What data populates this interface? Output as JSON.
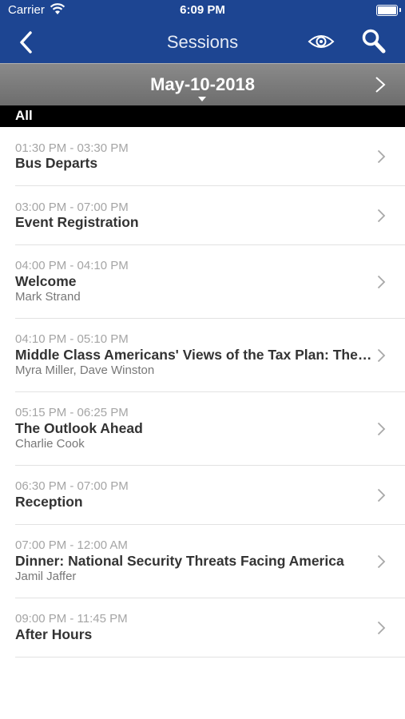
{
  "status_bar": {
    "carrier": "Carrier",
    "time": "6:09 PM"
  },
  "nav": {
    "title": "Sessions",
    "back_icon": "chevron-left-icon",
    "view_icon": "eye-icon",
    "search_icon": "search-icon"
  },
  "date_bar": {
    "date": "May-10-2018"
  },
  "filter": {
    "label": "All"
  },
  "sessions": [
    {
      "time": "01:30 PM - 03:30 PM",
      "title": "Bus Departs",
      "speakers": ""
    },
    {
      "time": "03:00 PM - 07:00 PM",
      "title": "Event Registration",
      "speakers": ""
    },
    {
      "time": "04:00 PM - 04:10 PM",
      "title": "Welcome",
      "speakers": "Mark Strand"
    },
    {
      "time": "04:10 PM - 05:10 PM",
      "title": "Middle Class Americans' Views of the Tax Plan: The Outlook",
      "speakers": "Myra Miller, Dave Winston"
    },
    {
      "time": "05:15 PM - 06:25 PM",
      "title": "The Outlook Ahead",
      "speakers": "Charlie Cook"
    },
    {
      "time": "06:30 PM - 07:00 PM",
      "title": "Reception",
      "speakers": ""
    },
    {
      "time": "07:00 PM - 12:00 AM",
      "title": "Dinner: National Security Threats Facing America",
      "speakers": "Jamil Jaffer"
    },
    {
      "time": "09:00 PM - 11:45 PM",
      "title": "After Hours",
      "speakers": ""
    }
  ]
}
